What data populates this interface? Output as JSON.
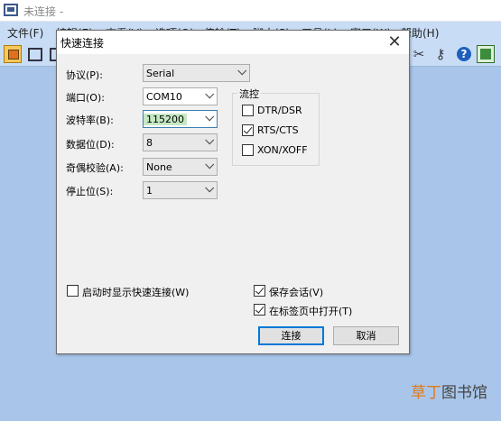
{
  "window": {
    "title": "未连接 -"
  },
  "menu": [
    "文件(F)",
    "编辑(E)",
    "查看(V)",
    "选项(O)",
    "传输(T)",
    "脚本(S)",
    "工具(L)",
    "窗口(W)",
    "帮助(H)"
  ],
  "toolbar": {
    "buttons": [
      "connect-icon",
      "quick-connect-icon",
      "session-icon",
      "tools-icon",
      "key-icon",
      "help-icon",
      "extension-icon"
    ]
  },
  "dialog": {
    "title": "快速连接",
    "close": "✕",
    "protocol": {
      "label": "协议(P):",
      "value": "Serial"
    },
    "port": {
      "label": "端口(O):",
      "value": "COM10"
    },
    "baud": {
      "label": "波特率(B):",
      "value": "115200"
    },
    "databits": {
      "label": "数据位(D):",
      "value": "8"
    },
    "parity": {
      "label": "奇偶校验(A):",
      "value": "None"
    },
    "stopbits": {
      "label": "停止位(S):",
      "value": "1"
    },
    "flow": {
      "title": "流控",
      "items": [
        {
          "label": "DTR/DSR",
          "checked": false
        },
        {
          "label": "RTS/CTS",
          "checked": true
        },
        {
          "label": "XON/XOFF",
          "checked": false
        }
      ]
    },
    "show_on_startup": {
      "label": "启动时显示快速连接(W)",
      "checked": false
    },
    "save_session": {
      "label": "保存会话(V)",
      "checked": true
    },
    "open_in_tab": {
      "label": "在标签页中打开(T)",
      "checked": true
    },
    "connect_label": "连接",
    "cancel_label": "取消"
  },
  "watermark": {
    "part1": "草丁",
    "part2": "图书馆"
  }
}
